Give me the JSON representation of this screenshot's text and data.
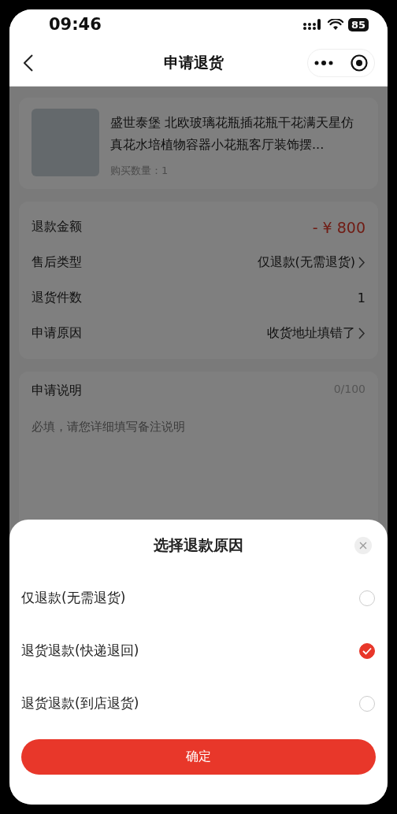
{
  "status_bar": {
    "time": "09:46",
    "battery": "85"
  },
  "nav": {
    "title": "申请退货"
  },
  "product": {
    "title": "盛世泰堡 北欧玻璃花瓶插花瓶干花满天星仿真花水培植物容器小花瓶客厅装饰摆...",
    "quantity": "购买数量：1"
  },
  "details": [
    {
      "label": "退款金额",
      "value": "- ¥ 800",
      "kind": "amount"
    },
    {
      "label": "售后类型",
      "value": "仅退款(无需退货)",
      "kind": "link"
    },
    {
      "label": "退货件数",
      "value": "1",
      "kind": "plain"
    },
    {
      "label": "申请原因",
      "value": "收货地址填错了",
      "kind": "link"
    }
  ],
  "note": {
    "label": "申请说明",
    "counter": "0/100",
    "placeholder": "必填，请您详细填写备注说明"
  },
  "sheet": {
    "title": "选择退款原因",
    "options": [
      {
        "label": "仅退款(无需退货)",
        "selected": false
      },
      {
        "label": "退货退款(快递退回)",
        "selected": true
      },
      {
        "label": "退货退款(到店退货)",
        "selected": false
      }
    ],
    "confirm": "确定"
  }
}
